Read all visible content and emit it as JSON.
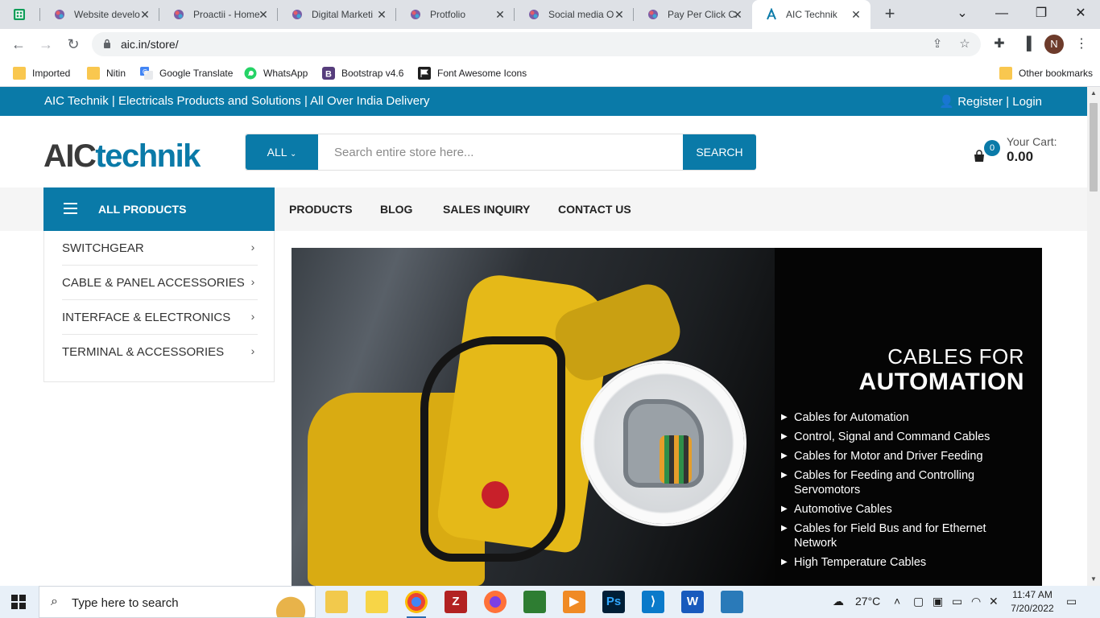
{
  "browser": {
    "tabs": [
      {
        "title": "",
        "icon": "sheets-icon"
      },
      {
        "title": "Website develo",
        "icon": "site-icon"
      },
      {
        "title": "Proactii - Home",
        "icon": "site-icon"
      },
      {
        "title": "Digital Marketi",
        "icon": "site-icon"
      },
      {
        "title": "Protfolio",
        "icon": "site-icon"
      },
      {
        "title": "Social media O",
        "icon": "site-icon"
      },
      {
        "title": "Pay Per Click Ca",
        "icon": "site-icon"
      },
      {
        "title": "AIC Technik",
        "icon": "site-icon",
        "active": true
      }
    ],
    "url": "aic.in/store/",
    "profile_initial": "N"
  },
  "bookmarks": [
    {
      "label": "Imported"
    },
    {
      "label": "Nitin"
    },
    {
      "label": "Google Translate"
    },
    {
      "label": "WhatsApp"
    },
    {
      "label": "Bootstrap v4.6"
    },
    {
      "label": "Font Awesome Icons"
    }
  ],
  "other_bookmarks": "Other bookmarks",
  "site": {
    "topbar": {
      "tagline": "AIC Technik | Electricals Products and Solutions | All Over India Delivery",
      "register": "Register",
      "separator": "|",
      "login": "Login"
    },
    "logo": {
      "part1": "AIC",
      "part2": "technik"
    },
    "search": {
      "category": "ALL",
      "placeholder": "Search entire store here...",
      "button": "SEARCH"
    },
    "cart": {
      "count": "0",
      "label": "Your Cart:",
      "amount": "0.00"
    },
    "nav": {
      "all_products": "ALL PRODUCTS",
      "items": [
        "PRODUCTS",
        "BLOG",
        "SALES INQUIRY",
        "CONTACT US"
      ]
    },
    "categories": [
      "SWITCHGEAR",
      "CABLE & PANEL ACCESSORIES",
      "INTERFACE & ELECTRONICS",
      "TERMINAL & ACCESSORIES"
    ],
    "banner": {
      "title_line1": "CABLES FOR",
      "title_line2": "AUTOMATION",
      "bullets": [
        "Cables for Automation",
        "Control, Signal and Command Cables",
        "Cables for Motor and Driver Feeding",
        "Cables for Feeding and Controlling Servomotors",
        "Automotive Cables",
        "Cables for Field Bus and for Ethernet Network",
        "High Temperature Cables"
      ]
    }
  },
  "taskbar": {
    "search_placeholder": "Type here to search",
    "weather": "27°C",
    "time": "11:47 AM",
    "date": "7/20/2022"
  },
  "colors": {
    "brand": "#0a7aa8"
  }
}
